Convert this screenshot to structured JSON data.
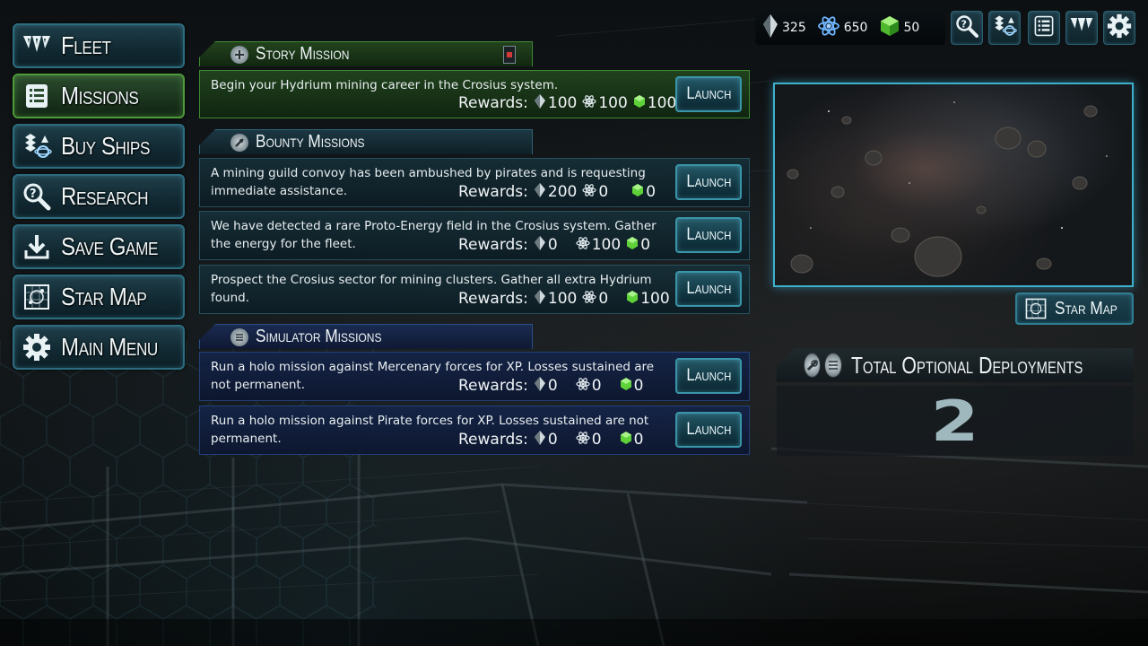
{
  "nav": {
    "items": [
      {
        "label": "Fleet",
        "icon": "fleet-icon",
        "active": false
      },
      {
        "label": "Missions",
        "icon": "missions-list-icon",
        "active": true
      },
      {
        "label": "Buy Ships",
        "icon": "buy-ships-icon",
        "active": false
      },
      {
        "label": "Research",
        "icon": "research-magnifier-icon",
        "active": false
      },
      {
        "label": "Save Game",
        "icon": "save-download-icon",
        "active": false
      },
      {
        "label": "Star Map",
        "icon": "star-map-icon",
        "active": false
      },
      {
        "label": "Main Menu",
        "icon": "gear-icon",
        "active": false
      }
    ]
  },
  "resources": {
    "crystal": "325",
    "atom": "650",
    "hydrium": "50"
  },
  "sections": {
    "story": {
      "title": "Story Mission",
      "missions": [
        {
          "description": "Begin your Hydrium mining career in the Crosius system.",
          "rewards_label": "Rewards:",
          "crystal": "100",
          "atom": "100",
          "hydrium": "100",
          "launch_label": "Launch"
        }
      ]
    },
    "bounty": {
      "title": "Bounty Missions",
      "missions": [
        {
          "description": "A mining guild convoy has been ambushed by pirates and is requesting immediate assistance.",
          "rewards_label": "Rewards:",
          "crystal": "200",
          "atom": "0",
          "hydrium": "0",
          "launch_label": "Launch"
        },
        {
          "description": "We have detected a rare Proto-Energy field in the Crosius system.  Gather the energy for the fleet.",
          "rewards_label": "Rewards:",
          "crystal": "0",
          "atom": "100",
          "hydrium": "0",
          "launch_label": "Launch"
        },
        {
          "description": "Prospect the Crosius sector for mining clusters.  Gather all extra Hydrium found.",
          "rewards_label": "Rewards:",
          "crystal": "100",
          "atom": "0",
          "hydrium": "100",
          "launch_label": "Launch"
        }
      ]
    },
    "simulator": {
      "title": "Simulator Missions",
      "missions": [
        {
          "description": "Run a holo mission against Mercenary forces for XP.  Losses sustained are not permanent.",
          "rewards_label": "Rewards:",
          "crystal": "0",
          "atom": "0",
          "hydrium": "0",
          "launch_label": "Launch"
        },
        {
          "description": "Run a holo mission against Pirate forces for XP.  Losses sustained are not permanent.",
          "rewards_label": "Rewards:",
          "crystal": "0",
          "atom": "0",
          "hydrium": "0",
          "launch_label": "Launch"
        }
      ]
    }
  },
  "map_panel": {
    "star_map_label": "Star Map"
  },
  "deployments": {
    "title": "Total Optional Deployments",
    "count": "2"
  },
  "colors": {
    "accent": "#3fb0cc",
    "story_green": "#3d8a30",
    "simulator_blue": "#243f78",
    "hydrium_green": "#5fd23a",
    "atom_blue": "#6fb6ff"
  }
}
